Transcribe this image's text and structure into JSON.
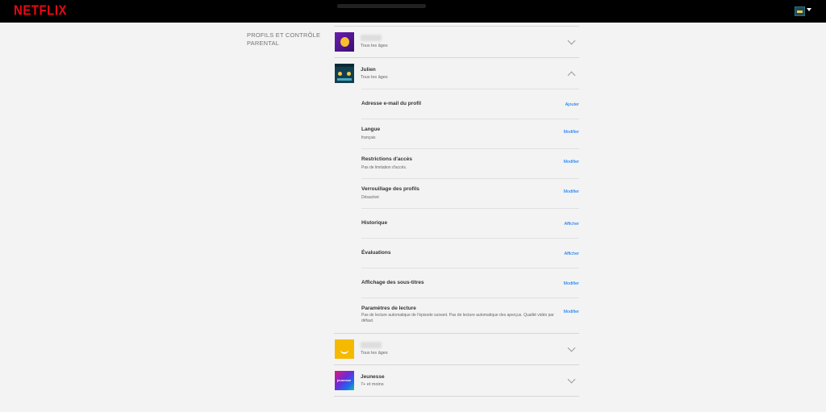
{
  "header": {
    "logo": "NETFLIX"
  },
  "section": {
    "title": "PROFILS ET CONTRÔLE PARENTAL"
  },
  "profiles": [
    {
      "name": "",
      "restriction": "Tous les âges",
      "expanded": false,
      "icon": "profile-avatar-purple"
    },
    {
      "name": "Julien",
      "restriction": "Tous les âges",
      "expanded": true,
      "icon": "profile-avatar-teal"
    },
    {
      "name": "",
      "restriction": "Tous les âges",
      "expanded": false,
      "icon": "profile-avatar-yellow"
    },
    {
      "name": "Jeunesse",
      "restriction": "7+ et moins",
      "expanded": false,
      "icon": "profile-avatar-kids"
    }
  ],
  "settings": [
    {
      "title": "Adresse e-mail du profil",
      "value": "",
      "action": "Ajouter"
    },
    {
      "title": "Langue",
      "value": "français",
      "action": "Modifier"
    },
    {
      "title": "Restrictions d'accès",
      "value": "Pas de limitation d'accès.",
      "action": "Modifier"
    },
    {
      "title": "Verrouillage des profils",
      "value": "Désactivé",
      "action": "Modifier"
    },
    {
      "title": "Historique",
      "value": "",
      "action": "Afficher"
    },
    {
      "title": "Évaluations",
      "value": "",
      "action": "Afficher"
    },
    {
      "title": "Affichage des sous-titres",
      "value": "",
      "action": "Modifier"
    },
    {
      "title": "Paramètres de lecture",
      "value": "Pas de lecture automatique de l'épisode suivant. Pas de lecture automatique des aperçus. Qualité vidéo par défaut.",
      "action": "Modifier"
    }
  ],
  "colors": {
    "brand": "#e50914",
    "link": "#0071eb"
  }
}
